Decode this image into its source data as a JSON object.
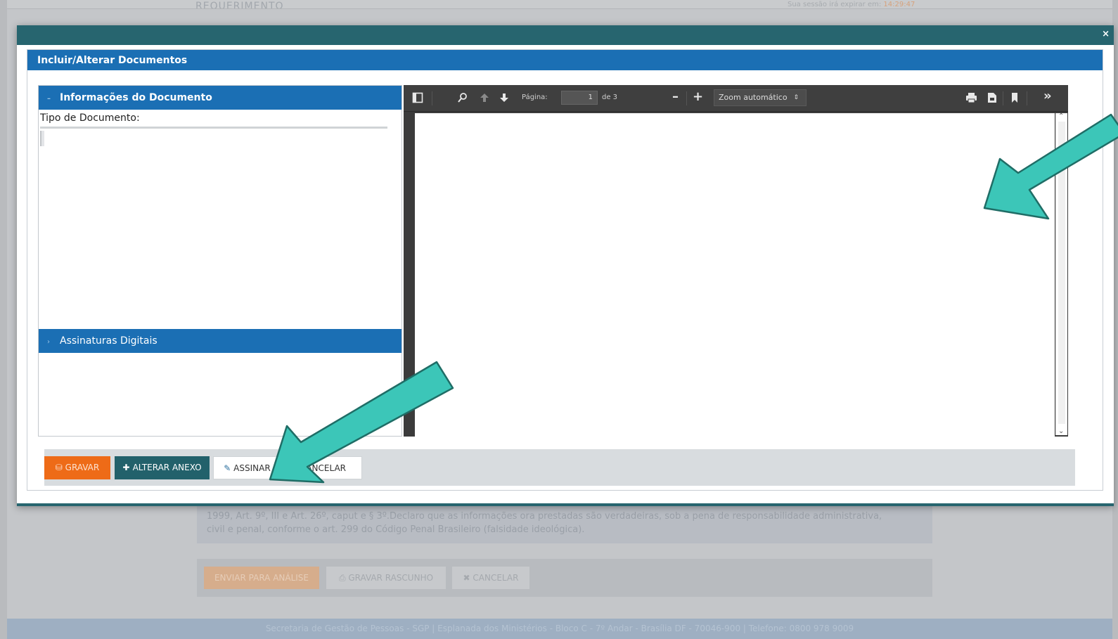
{
  "background": {
    "page_title": "REQUERIMENTO",
    "session_text": "Sua sessão irá expirar em: ",
    "session_count": "14:29:47",
    "declaration_line1": "1999, Art. 9º, III e Art. 26º, caput e § 3º.Declaro que as informações ora prestadas são verdadeiras, sob a pena de responsabilidade administrativa,",
    "declaration_line2": "civil e penal, conforme o art. 299 do Código Penal Brasileiro (falsidade ideológica).",
    "send_button": "ENVIAR PARA ANÁLISE",
    "draft_button": "GRAVAR RASCUNHO",
    "cancel_button": "CANCELAR",
    "footer": "Secretaria de Gestão de Pessoas - SGP | Esplanada dos Ministérios - Bloco C - 7º Andar - Brasília DF - 70046-900 | Telefone: 0800 978 9009"
  },
  "modal": {
    "close_glyph": "×",
    "panel_title": "Incluir/Alterar Documentos",
    "info_section": {
      "title": "Informações do Documento",
      "field_label": "Tipo de Documento:"
    },
    "signatures_section": {
      "title": "Assinaturas Digitais"
    },
    "viewer": {
      "page_label": "Página:",
      "page_value": "1",
      "page_total": "de 3",
      "zoom_value": "Zoom automático",
      "icons": [
        "sidebar-toggle-icon",
        "search-icon",
        "previous-page-icon",
        "next-page-icon",
        "zoom-out-icon",
        "zoom-in-icon",
        "print-icon",
        "download-icon",
        "bookmark-icon",
        "tools-icon"
      ]
    },
    "buttons": {
      "save": "GRAVAR",
      "change_attachment": "ALTERAR ANEXO",
      "sign": "ASSINAR",
      "cancel": "CANCELAR"
    }
  },
  "colors": {
    "modal_header": "#27656f",
    "panel_blue": "#1b6fb4",
    "save_orange": "#ee6b17",
    "arrow_teal": "#3cc6b8"
  }
}
